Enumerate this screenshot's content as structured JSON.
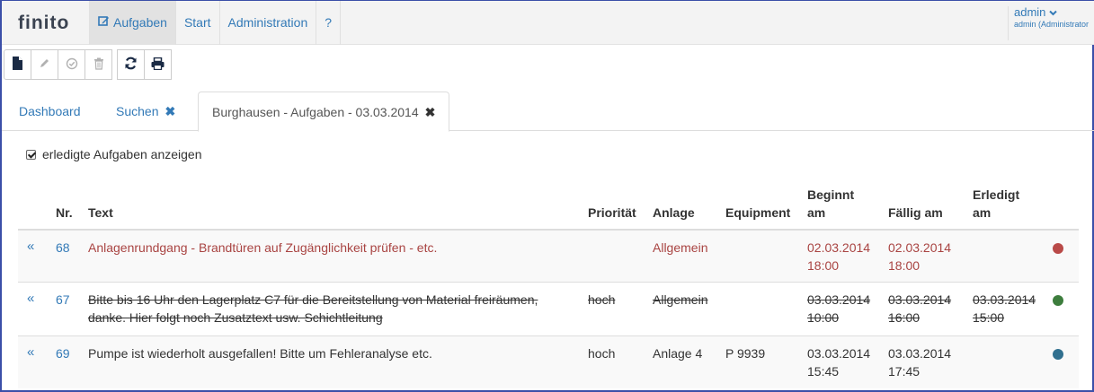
{
  "app": {
    "brand": "finito"
  },
  "nav": {
    "items": [
      {
        "label": "Aufgaben",
        "icon": "edit-icon"
      },
      {
        "label": "Start"
      },
      {
        "label": "Administration"
      },
      {
        "label": "?"
      }
    ]
  },
  "user": {
    "name": "admin",
    "role": "admin (Administrator"
  },
  "toolbar": {
    "buttons": [
      "new-document-icon",
      "pencil-icon",
      "check-circle-icon",
      "trash-icon",
      "refresh-icon",
      "print-icon"
    ]
  },
  "tabs": [
    {
      "label": "Dashboard"
    },
    {
      "label": "Suchen",
      "close": "✖"
    },
    {
      "label": "Burghausen - Aufgaben - 03.03.2014",
      "close": "✖"
    }
  ],
  "filter": {
    "show_done_label": "erledigte Aufgaben anzeigen",
    "checked": true
  },
  "table": {
    "headers": {
      "nr": "Nr.",
      "text": "Text",
      "prioritaet": "Priorität",
      "anlage": "Anlage",
      "equipment": "Equipment",
      "beginnt_1": "Beginnt",
      "beginnt_2": "am",
      "faellig": "Fällig am",
      "erledigt_1": "Erledigt",
      "erledigt_2": "am"
    },
    "rows": [
      {
        "arrow": "«",
        "nr": "68",
        "text_1": "Anlagenrundgang - Brandtüren auf Zugänglichkeit prüfen - etc.",
        "text_2": "",
        "prioritaet": "",
        "anlage": "Allgemein",
        "equipment": "",
        "beginnt_date": "02.03.2014",
        "beginnt_time": "18:00",
        "faellig_date": "02.03.2014",
        "faellig_time": "18:00",
        "erledigt_date": "",
        "erledigt_time": "",
        "status_color": "#b94a48"
      },
      {
        "arrow": "«",
        "nr": "67",
        "text_1": "Bitte bis 16 Uhr den Lagerplatz C7 für die Bereitstellung von Material freiräumen,",
        "text_2": "danke. Hier folgt noch Zusatztext usw. Schichtleitung",
        "prioritaet": "hoch",
        "anlage": "Allgemein",
        "equipment": "",
        "beginnt_date": "03.03.2014",
        "beginnt_time": "10:00",
        "faellig_date": "03.03.2014",
        "faellig_time": "16:00",
        "erledigt_date": "03.03.2014",
        "erledigt_time": "15:00",
        "status_color": "#3d7d3d"
      },
      {
        "arrow": "«",
        "nr": "69",
        "text_1": "Pumpe ist wiederholt ausgefallen! Bitte um Fehleranalyse etc.",
        "text_2": "",
        "prioritaet": "hoch",
        "anlage": "Anlage 4",
        "equipment": "P 9939",
        "beginnt_date": "03.03.2014",
        "beginnt_time": "15:45",
        "faellig_date": "03.03.2014",
        "faellig_time": "17:45",
        "erledigt_date": "",
        "erledigt_time": "",
        "status_color": "#31708f"
      }
    ]
  },
  "colors": {
    "link": "#337ab7",
    "overdue": "#a94442",
    "frame": "#3b4fa8"
  }
}
